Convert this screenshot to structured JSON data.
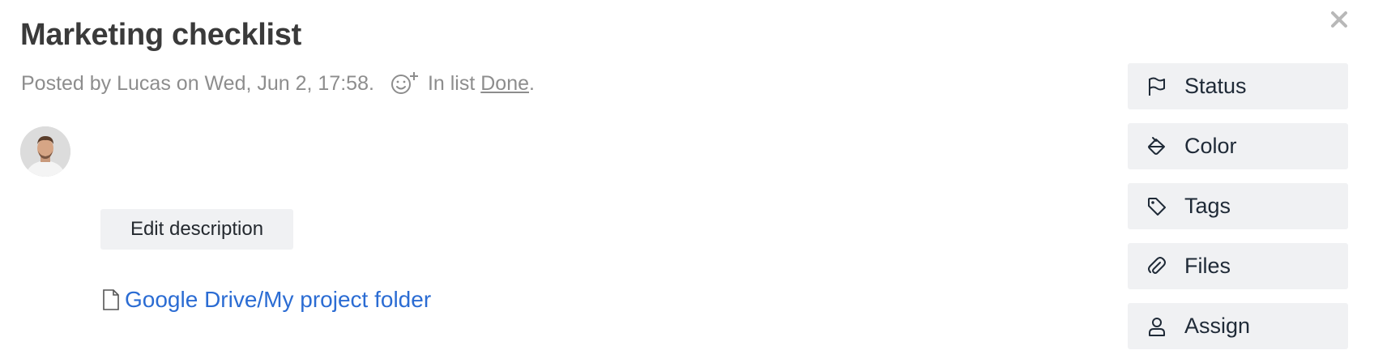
{
  "dialog": {
    "close_icon": "close-icon"
  },
  "card": {
    "title": "Marketing checklist",
    "meta_prefix": "Posted by Lucas on Wed, Jun 2, 17:58.",
    "meta_list_prefix": "In list",
    "list_name": "Done",
    "meta_suffix": ".",
    "edit_description_label": "Edit description",
    "attachment_label": "Google Drive/My project folder",
    "link_color": "#2b6cd3"
  },
  "sidebar": {
    "items": [
      {
        "label": "Status",
        "icon": "flag-icon"
      },
      {
        "label": "Color",
        "icon": "paint-bucket-icon"
      },
      {
        "label": "Tags",
        "icon": "tag-icon"
      },
      {
        "label": "Files",
        "icon": "paperclip-icon"
      },
      {
        "label": "Assign",
        "icon": "user-icon"
      }
    ]
  }
}
